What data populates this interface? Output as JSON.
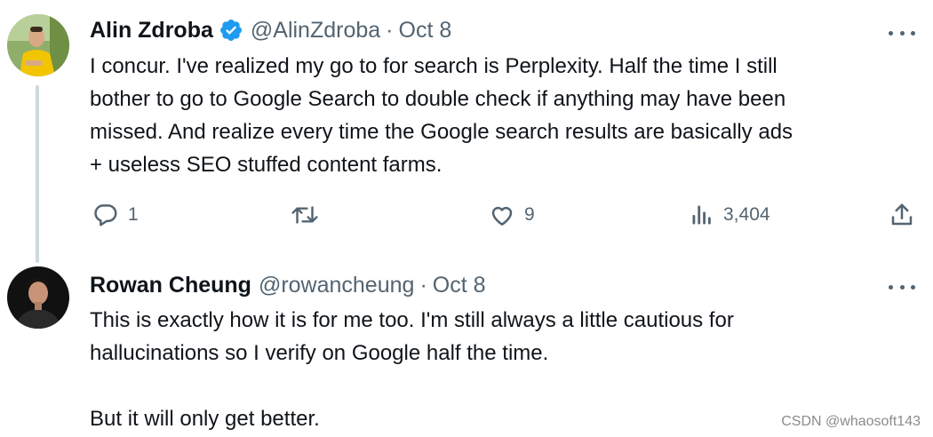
{
  "tweets": [
    {
      "author_name": "Alin Zdroba",
      "verified": true,
      "handle": "@AlinZdroba",
      "separator": "·",
      "date": "Oct 8",
      "text": "I concur. I've realized my go to for search is Perplexity. Half the time I still\nbother to go to Google Search to double check if anything may have been\nmissed. And realize every time the Google search results are basically ads\n+ useless SEO stuffed content farms.",
      "actions": {
        "reply_count": "1",
        "retweet_count": "",
        "like_count": "9",
        "view_count": "3,404"
      }
    },
    {
      "author_name": "Rowan Cheung",
      "verified": false,
      "handle": "@rowancheung",
      "separator": "·",
      "date": "Oct 8",
      "text": "This is exactly how it is for me too. I'm still always a little cautious for\nhallucinations so I verify on Google half the time.\n\nBut it will only get better."
    }
  ],
  "icons": {
    "more": "more-icon",
    "verified": "verified-badge-icon",
    "reply": "reply-icon",
    "retweet": "retweet-icon",
    "like": "like-icon",
    "views": "views-icon",
    "share": "share-icon"
  },
  "colors": {
    "text": "#0f1419",
    "secondary_text": "#536471",
    "verified_blue": "#1d9bf0",
    "thread_line": "#cfd9de"
  },
  "watermark": "CSDN @whaosoft143"
}
